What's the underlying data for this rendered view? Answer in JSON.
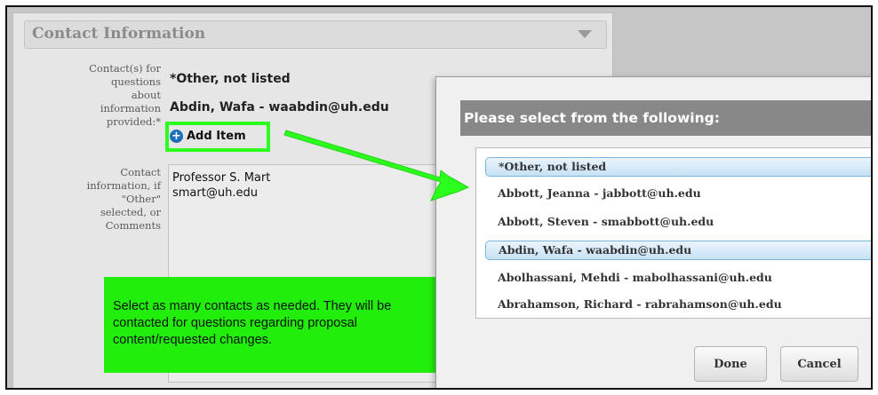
{
  "section": {
    "title": "Contact Information"
  },
  "fields": {
    "contacts_label": "Contact(s) for\nquestions\nabout\ninformation\nprovided:*",
    "contacts_selected": [
      "*Other, not listed",
      "Abdin, Wafa - waabdin@uh.edu"
    ],
    "add_item_label": "Add Item",
    "contact_info_label": "Contact\ninformation, if\n\"Other\"\nselected, or\nComments",
    "contact_info_value": "Professor S. Mart\nsmart@uh.edu"
  },
  "annotation": {
    "note": "Select as many contacts as needed. They will be contacted for questions regarding proposal content/requested changes.",
    "highlight_color": "#22ee0c"
  },
  "modal": {
    "title": "Please select from the following:",
    "options": [
      {
        "label": "*Other, not listed",
        "selected": true
      },
      {
        "label": "Abbott, Jeanna - jabbott@uh.edu",
        "selected": false
      },
      {
        "label": "Abbott, Steven - smabbott@uh.edu",
        "selected": false
      },
      {
        "label": "Abdin, Wafa - waabdin@uh.edu",
        "selected": true
      },
      {
        "label": "Abolhassani, Mehdi - mabolhassani@uh.edu",
        "selected": false
      },
      {
        "label": "Abrahamson, Richard - rabrahamson@uh.edu",
        "selected": false
      }
    ],
    "done_label": "Done",
    "cancel_label": "Cancel"
  },
  "icons": {
    "add": "plus-circle-icon",
    "collapse": "triangle-down-icon"
  }
}
